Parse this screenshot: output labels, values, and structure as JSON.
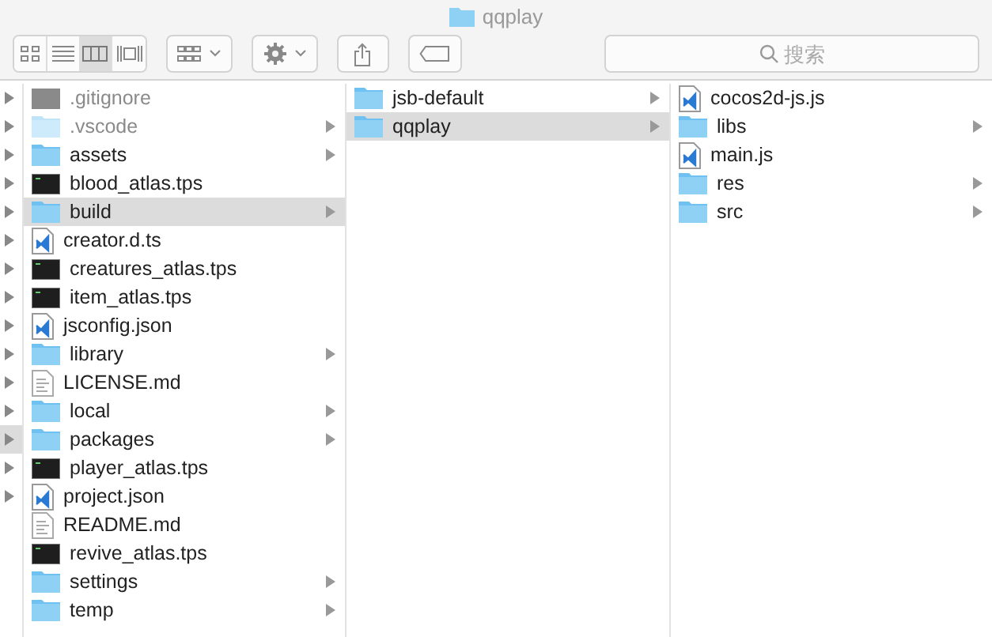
{
  "window": {
    "title": "qqplay"
  },
  "toolbar": {
    "view_modes": [
      {
        "kind": "icons",
        "selected": false
      },
      {
        "kind": "list",
        "selected": false
      },
      {
        "kind": "columns",
        "selected": true
      },
      {
        "kind": "gallery",
        "selected": false
      }
    ],
    "search": {
      "placeholder": "搜索"
    }
  },
  "parent_column": [
    {
      "selected": false
    },
    {
      "selected": false
    },
    {
      "selected": false
    },
    {
      "selected": false
    },
    {
      "selected": false
    },
    {
      "selected": false
    },
    {
      "selected": false
    },
    {
      "selected": false
    },
    {
      "selected": false
    },
    {
      "selected": false
    },
    {
      "selected": false
    },
    {
      "selected": false
    },
    {
      "selected": true
    },
    {
      "selected": false
    },
    {
      "selected": false
    }
  ],
  "columns": [
    [
      {
        "name": ".gitignore",
        "kind": "file",
        "dimmed": true,
        "folder": false,
        "selected": false
      },
      {
        "name": ".vscode",
        "kind": "folder",
        "dimmed": true,
        "folder": true,
        "selected": false
      },
      {
        "name": "assets",
        "kind": "folder",
        "dimmed": false,
        "folder": true,
        "selected": false
      },
      {
        "name": "blood_atlas.tps",
        "kind": "terminal",
        "dimmed": false,
        "folder": false,
        "selected": false
      },
      {
        "name": "build",
        "kind": "folder",
        "dimmed": false,
        "folder": true,
        "selected": true
      },
      {
        "name": "creator.d.ts",
        "kind": "code",
        "dimmed": false,
        "folder": false,
        "selected": false
      },
      {
        "name": "creatures_atlas.tps",
        "kind": "terminal",
        "dimmed": false,
        "folder": false,
        "selected": false
      },
      {
        "name": "item_atlas.tps",
        "kind": "terminal",
        "dimmed": false,
        "folder": false,
        "selected": false
      },
      {
        "name": "jsconfig.json",
        "kind": "code",
        "dimmed": false,
        "folder": false,
        "selected": false
      },
      {
        "name": "library",
        "kind": "folder",
        "dimmed": false,
        "folder": true,
        "selected": false
      },
      {
        "name": "LICENSE.md",
        "kind": "text",
        "dimmed": false,
        "folder": false,
        "selected": false
      },
      {
        "name": "local",
        "kind": "folder",
        "dimmed": false,
        "folder": true,
        "selected": false
      },
      {
        "name": "packages",
        "kind": "folder",
        "dimmed": false,
        "folder": true,
        "selected": false
      },
      {
        "name": "player_atlas.tps",
        "kind": "terminal",
        "dimmed": false,
        "folder": false,
        "selected": false
      },
      {
        "name": "project.json",
        "kind": "code",
        "dimmed": false,
        "folder": false,
        "selected": false
      },
      {
        "name": "README.md",
        "kind": "text",
        "dimmed": false,
        "folder": false,
        "selected": false
      },
      {
        "name": "revive_atlas.tps",
        "kind": "terminal",
        "dimmed": false,
        "folder": false,
        "selected": false
      },
      {
        "name": "settings",
        "kind": "folder",
        "dimmed": false,
        "folder": true,
        "selected": false
      },
      {
        "name": "temp",
        "kind": "folder",
        "dimmed": false,
        "folder": true,
        "selected": false
      }
    ],
    [
      {
        "name": "jsb-default",
        "kind": "folder",
        "dimmed": false,
        "folder": true,
        "selected": false
      },
      {
        "name": "qqplay",
        "kind": "folder",
        "dimmed": false,
        "folder": true,
        "selected": true
      }
    ],
    [
      {
        "name": "cocos2d-js.js",
        "kind": "code",
        "dimmed": false,
        "folder": false,
        "selected": false
      },
      {
        "name": "libs",
        "kind": "folder",
        "dimmed": false,
        "folder": true,
        "selected": false
      },
      {
        "name": "main.js",
        "kind": "code",
        "dimmed": false,
        "folder": false,
        "selected": false
      },
      {
        "name": "res",
        "kind": "folder",
        "dimmed": false,
        "folder": true,
        "selected": false
      },
      {
        "name": "src",
        "kind": "folder",
        "dimmed": false,
        "folder": true,
        "selected": false
      }
    ]
  ]
}
